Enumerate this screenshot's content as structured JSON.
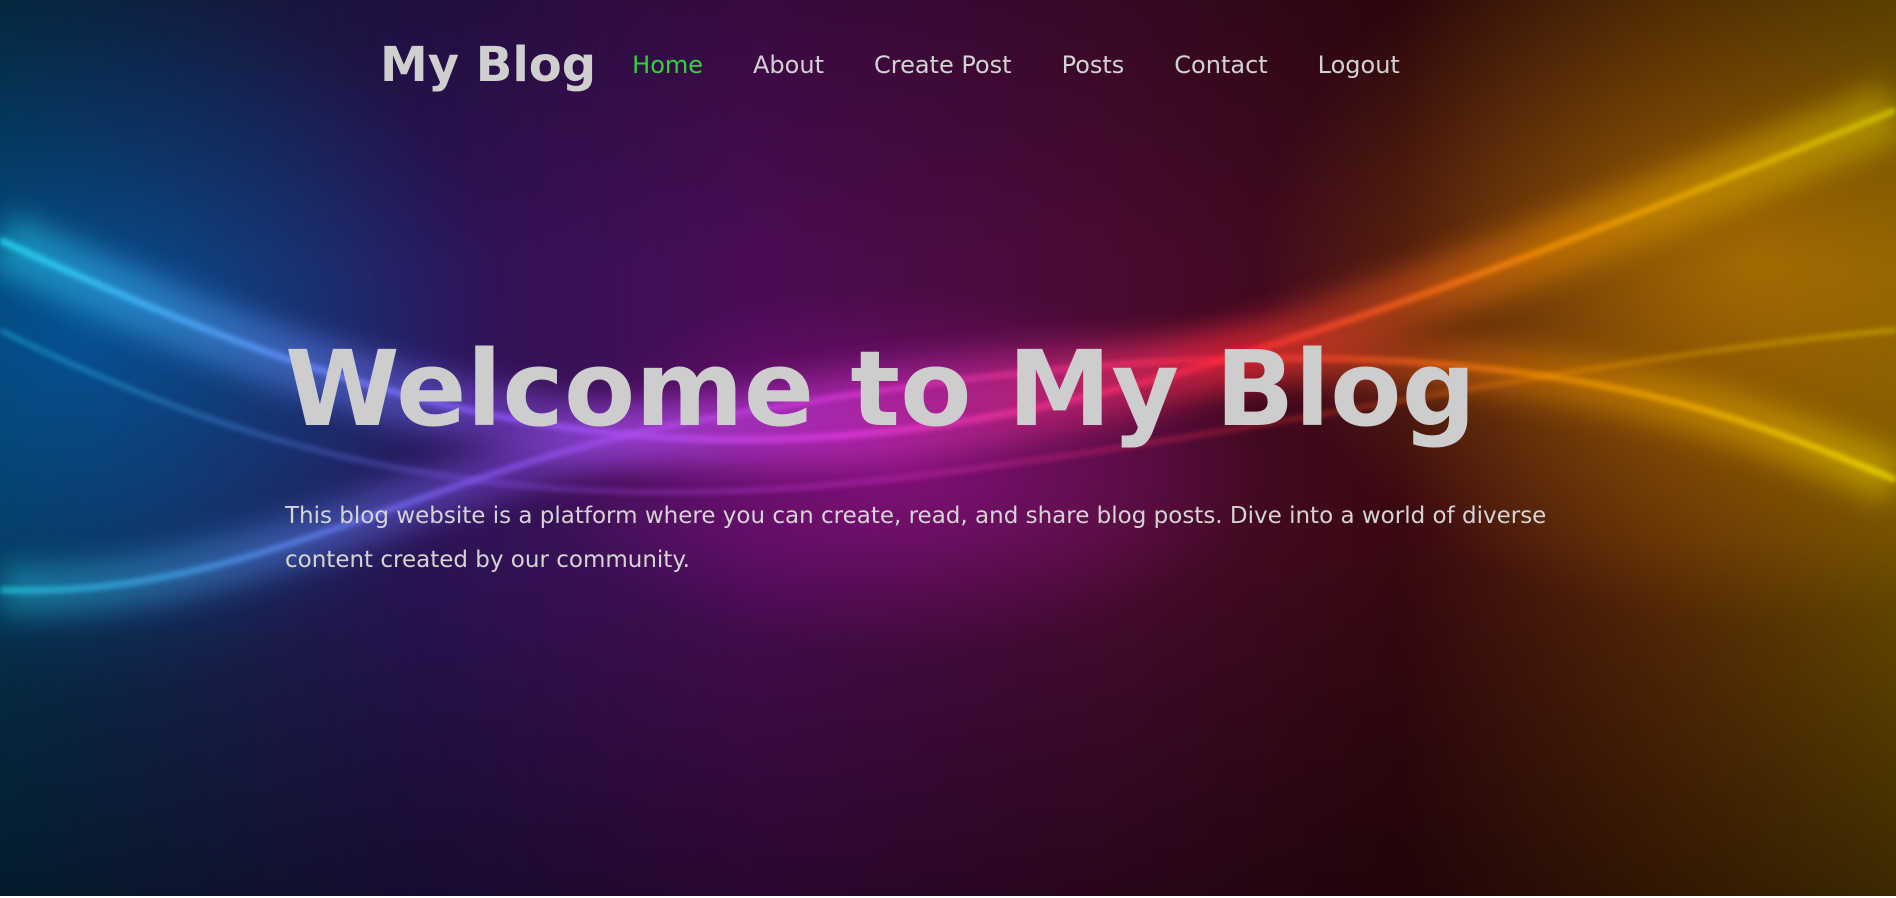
{
  "site": {
    "logo_text": "My Blog"
  },
  "nav": {
    "items": [
      {
        "label": "Home",
        "active": true
      },
      {
        "label": "About",
        "active": false
      },
      {
        "label": "Create Post",
        "active": false
      },
      {
        "label": "Posts",
        "active": false
      },
      {
        "label": "Contact",
        "active": false
      },
      {
        "label": "Logout",
        "active": false
      }
    ],
    "active_color": "#2fd43a"
  },
  "hero": {
    "title": "Welcome to My Blog",
    "description": "This blog website is a platform where you can create, read, and share blog posts. Dive into a world of diverse content created by our community."
  }
}
